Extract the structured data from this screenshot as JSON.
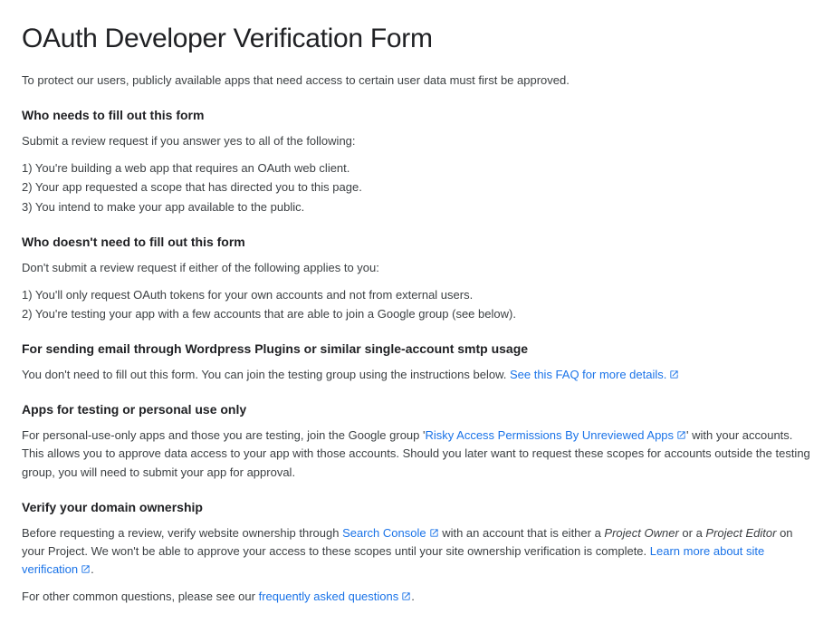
{
  "title": "OAuth Developer Verification Form",
  "intro": "To protect our users, publicly available apps that need access to certain user data must first be approved.",
  "s1": {
    "heading": "Who needs to fill out this form",
    "lead": "Submit a review request if you answer yes to all of the following:",
    "item1": "1) You're building a web app that requires an OAuth web client.",
    "item2": "2) Your app requested a scope that has directed you to this page.",
    "item3": "3) You intend to make your app available to the public."
  },
  "s2": {
    "heading": "Who doesn't need to fill out this form",
    "lead": "Don't submit a review request if either of the following applies to you:",
    "item1": "1) You'll only request OAuth tokens for your own accounts and not from external users.",
    "item2": "2) You're testing your app with a few accounts that are able to join a Google group (see below)."
  },
  "s3": {
    "heading": "For sending email through Wordpress Plugins or similar single-account smtp usage",
    "text_before": "You don't need to fill out this form. You can join the testing group using the instructions below. ",
    "link": "See this FAQ for more details."
  },
  "s4": {
    "heading": "Apps for testing or personal use only",
    "text_before": "For personal-use-only apps and those you are testing, join the Google group '",
    "link": "Risky Access Permissions By Unreviewed Apps",
    "text_after": "' with your accounts. This allows you to approve data access to your app with those accounts. Should you later want to request these scopes for accounts outside the testing group, you will need to submit your app for approval."
  },
  "s5": {
    "heading": "Verify your domain ownership",
    "text_before_a": "Before requesting a review, verify website ownership through ",
    "link_a": "Search Console",
    "text_mid1": " with an account that is either a ",
    "em1": "Project Owner",
    "text_mid2": " or a ",
    "em2": "Project Editor",
    "text_mid3": " on your Project. We won't be able to approve your access to these scopes until your site ownership verification is complete. ",
    "link_b": "Learn more about site verification",
    "text_after_b": "."
  },
  "s6": {
    "text_before": "For other common questions, please see our ",
    "link": "frequently asked questions",
    "text_after": "."
  }
}
